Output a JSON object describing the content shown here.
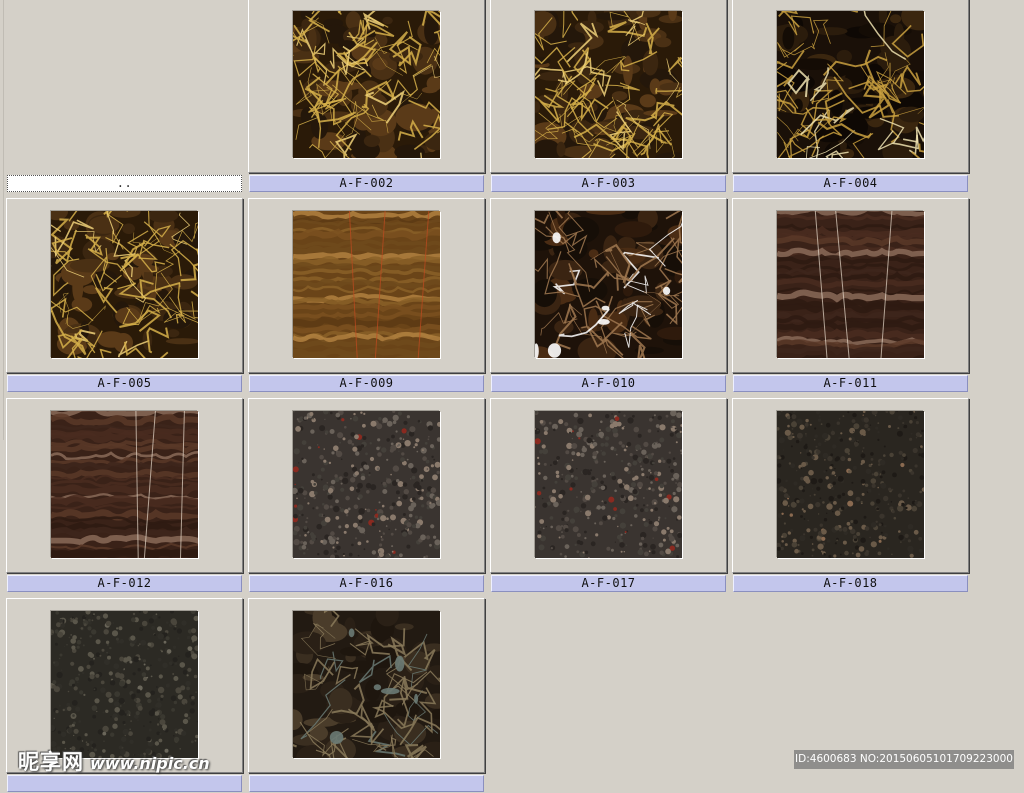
{
  "parent_folder": {
    "label": ".."
  },
  "thumbnails": [
    {
      "label": "A-F-002",
      "texture": "gold-vein-dark"
    },
    {
      "label": "A-F-003",
      "texture": "gold-vein-dark"
    },
    {
      "label": "A-F-004",
      "texture": "gold-vein-black"
    },
    {
      "label": "A-F-005",
      "texture": "gold-vein-dark"
    },
    {
      "label": "A-F-009",
      "texture": "amber-onyx"
    },
    {
      "label": "A-F-010",
      "texture": "brown-white-breccia"
    },
    {
      "label": "A-F-011",
      "texture": "brown-striated"
    },
    {
      "label": "A-F-012",
      "texture": "brown-striated"
    },
    {
      "label": "A-F-016",
      "texture": "grey-granite-red"
    },
    {
      "label": "A-F-017",
      "texture": "grey-granite-red"
    },
    {
      "label": "A-F-018",
      "texture": "dark-fossil-stone"
    },
    {
      "label": "",
      "texture": "dark-grey-stone"
    },
    {
      "label": "",
      "texture": "dark-brown-breccia"
    }
  ],
  "watermark": {
    "logo_text": "昵享网",
    "url_text": "www.nipic.cn",
    "id_text": "ID:4600683 NO:20150605101709223000"
  },
  "colors": {
    "window_bg": "#d4d0c8",
    "caption_bg": "#c3c6ec"
  }
}
